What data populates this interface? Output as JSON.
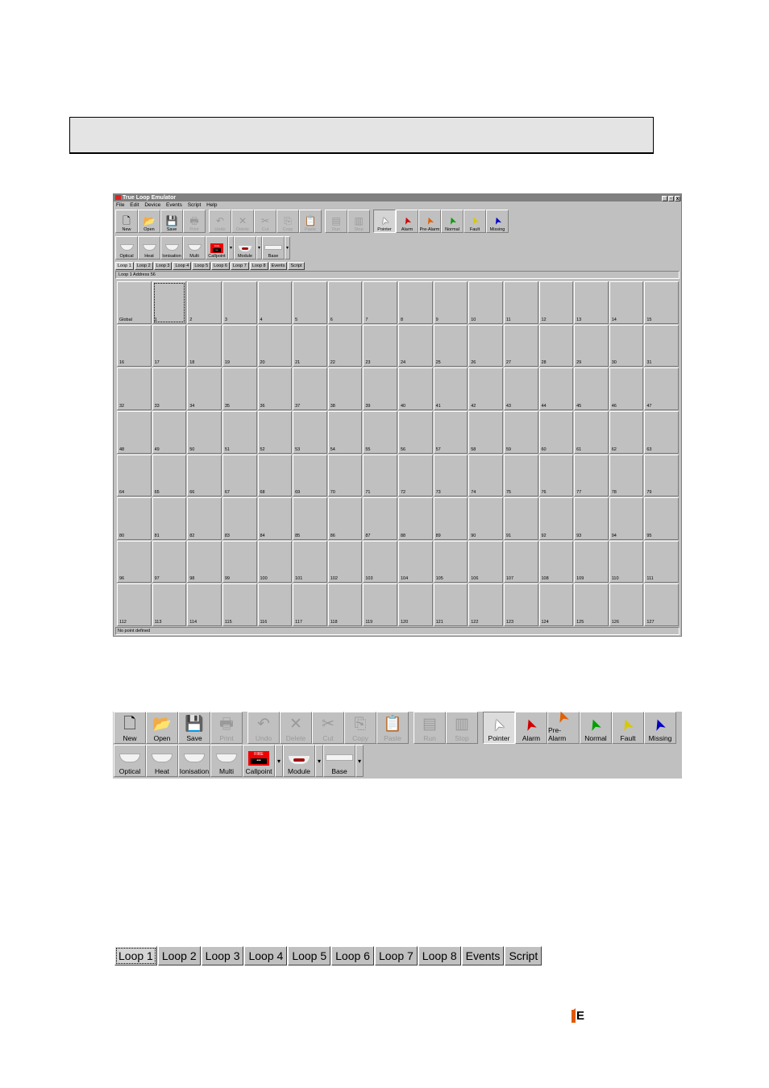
{
  "window": {
    "title": "True Loop Emulator",
    "buttons": [
      "_",
      "▫",
      "x"
    ],
    "menu": [
      "File",
      "Edit",
      "Device",
      "Events",
      "Script",
      "Help"
    ],
    "address_label": "Loop 1  Address 56",
    "status": "No point defined"
  },
  "toolbar_main": [
    {
      "label": "New",
      "icon": "new-icon",
      "glyph": "🗋",
      "disabled": false
    },
    {
      "label": "Open",
      "icon": "open-folder-icon",
      "glyph": "📂",
      "disabled": false
    },
    {
      "label": "Save",
      "icon": "save-icon",
      "glyph": "💾",
      "disabled": false
    },
    {
      "label": "Print",
      "icon": "print-icon",
      "glyph": "🖶",
      "disabled": true
    },
    {
      "label": "Undo",
      "icon": "undo-icon",
      "glyph": "↶",
      "disabled": true
    },
    {
      "label": "Delete",
      "icon": "delete-icon",
      "glyph": "✕",
      "disabled": true
    },
    {
      "label": "Cut",
      "icon": "cut-icon",
      "glyph": "✂",
      "disabled": true
    },
    {
      "label": "Copy",
      "icon": "copy-icon",
      "glyph": "⎘",
      "disabled": true
    },
    {
      "label": "Paste",
      "icon": "paste-icon",
      "glyph": "📋",
      "disabled": true
    },
    {
      "label": "Run",
      "icon": "run-icon",
      "glyph": "▤",
      "disabled": true
    },
    {
      "label": "Stop",
      "icon": "stop-icon",
      "glyph": "▥",
      "disabled": true
    },
    {
      "label": "Pointer",
      "icon": "pointer-white-icon",
      "glyph": "➤",
      "disabled": false,
      "active": true,
      "color": "#ffffff"
    },
    {
      "label": "Alarm",
      "icon": "pointer-red-icon",
      "glyph": "➤",
      "disabled": false,
      "color": "#d00000"
    },
    {
      "label": "Pre-Alarm",
      "icon": "pointer-orange-icon",
      "glyph": "➤",
      "disabled": false,
      "color": "#e06000"
    },
    {
      "label": "Normal",
      "icon": "pointer-green-icon",
      "glyph": "➤",
      "disabled": false,
      "color": "#00a000"
    },
    {
      "label": "Fault",
      "icon": "pointer-yellow-icon",
      "glyph": "➤",
      "disabled": false,
      "color": "#d8c800"
    },
    {
      "label": "Missing",
      "icon": "pointer-blue-icon",
      "glyph": "➤",
      "disabled": false,
      "color": "#0000c8"
    }
  ],
  "toolbar_devices": [
    {
      "label": "Optical",
      "icon": "optical-detector-icon"
    },
    {
      "label": "Heat",
      "icon": "heat-detector-icon"
    },
    {
      "label": "Ionisation",
      "icon": "ionisation-detector-icon"
    },
    {
      "label": "Multi",
      "icon": "multi-detector-icon"
    },
    {
      "label": "Callpoint",
      "icon": "callpoint-icon",
      "dropdown": true,
      "badge": "FIRE"
    },
    {
      "label": "Module",
      "icon": "module-icon",
      "dropdown": true
    },
    {
      "label": "Base",
      "icon": "base-icon",
      "dropdown": true
    }
  ],
  "small_tabs": [
    "Loop 1",
    "Loop 2",
    "Loop 3",
    "Loop 4",
    "Loop 5",
    "Loop 6",
    "Loop 7",
    "Loop 8",
    "Events",
    "Script"
  ],
  "big_tabs": [
    "Loop 1",
    "Loop 2",
    "Loop 3",
    "Loop 4",
    "Loop 5",
    "Loop 6",
    "Loop 7",
    "Loop 8",
    "Events",
    "Script"
  ],
  "selected_tab": "Loop 1",
  "grid_cells": [
    "Global",
    "1",
    "2",
    "3",
    "4",
    "5",
    "6",
    "7",
    "8",
    "9",
    "10",
    "11",
    "12",
    "13",
    "14",
    "15",
    "16",
    "17",
    "18",
    "19",
    "20",
    "21",
    "22",
    "23",
    "24",
    "25",
    "26",
    "27",
    "28",
    "29",
    "30",
    "31",
    "32",
    "33",
    "34",
    "35",
    "36",
    "37",
    "38",
    "39",
    "40",
    "41",
    "42",
    "43",
    "44",
    "45",
    "46",
    "47",
    "48",
    "49",
    "50",
    "51",
    "52",
    "53",
    "54",
    "55",
    "56",
    "57",
    "58",
    "59",
    "60",
    "61",
    "62",
    "63",
    "64",
    "65",
    "66",
    "67",
    "68",
    "69",
    "70",
    "71",
    "72",
    "73",
    "74",
    "75",
    "76",
    "77",
    "78",
    "79",
    "80",
    "81",
    "82",
    "83",
    "84",
    "85",
    "86",
    "87",
    "88",
    "89",
    "90",
    "91",
    "92",
    "93",
    "94",
    "95",
    "96",
    "97",
    "98",
    "99",
    "100",
    "101",
    "102",
    "103",
    "104",
    "105",
    "106",
    "107",
    "108",
    "109",
    "110",
    "111",
    "112",
    "113",
    "114",
    "115",
    "116",
    "117",
    "118",
    "119",
    "120",
    "121",
    "122",
    "123",
    "124",
    "125",
    "126",
    "127"
  ],
  "selected_cell": "1",
  "logo_letter": "E"
}
